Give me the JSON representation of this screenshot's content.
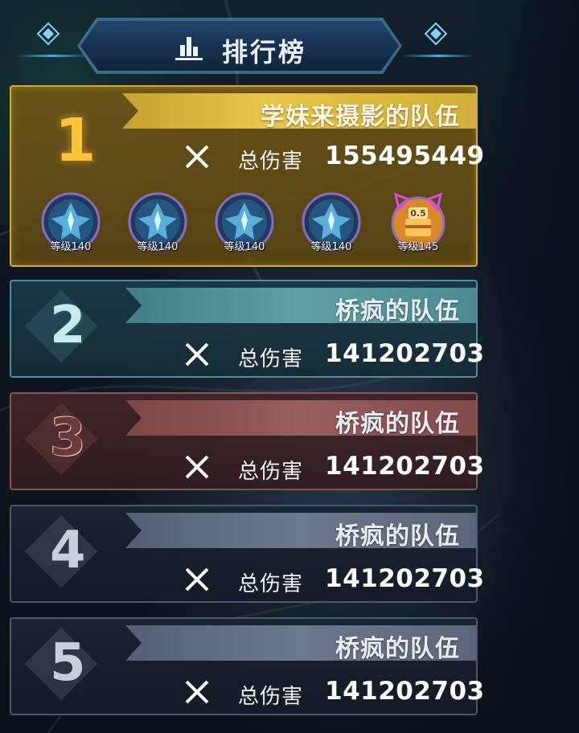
{
  "header": {
    "title": "排行榜",
    "icon": "bar-chart-icon"
  },
  "damage_label": "总伤害",
  "ranks": [
    {
      "rank": "1",
      "team": "学妹来摄影的队伍",
      "total_damage": "155495449",
      "color": "#e7c64a",
      "members": [
        {
          "level": "等级140",
          "icon": "crest-icon"
        },
        {
          "level": "等级140",
          "icon": "crest-icon"
        },
        {
          "level": "等级140",
          "icon": "crest-icon"
        },
        {
          "level": "等级140",
          "icon": "crest-icon"
        },
        {
          "level": "等级145",
          "icon": "cake-avatar-icon",
          "badge": "0.5"
        }
      ]
    },
    {
      "rank": "2",
      "team": "桥疯的队伍",
      "total_damage": "141202703",
      "color": "#5ea0a6"
    },
    {
      "rank": "3",
      "team": "桥疯的队伍",
      "total_damage": "141202703",
      "color": "#9a5e5c"
    },
    {
      "rank": "4",
      "team": "桥疯的队伍",
      "total_damage": "141202703",
      "color": "#6e788c"
    },
    {
      "rank": "5",
      "team": "桥疯的队伍",
      "total_damage": "141202703",
      "color": "#6e788c"
    }
  ]
}
